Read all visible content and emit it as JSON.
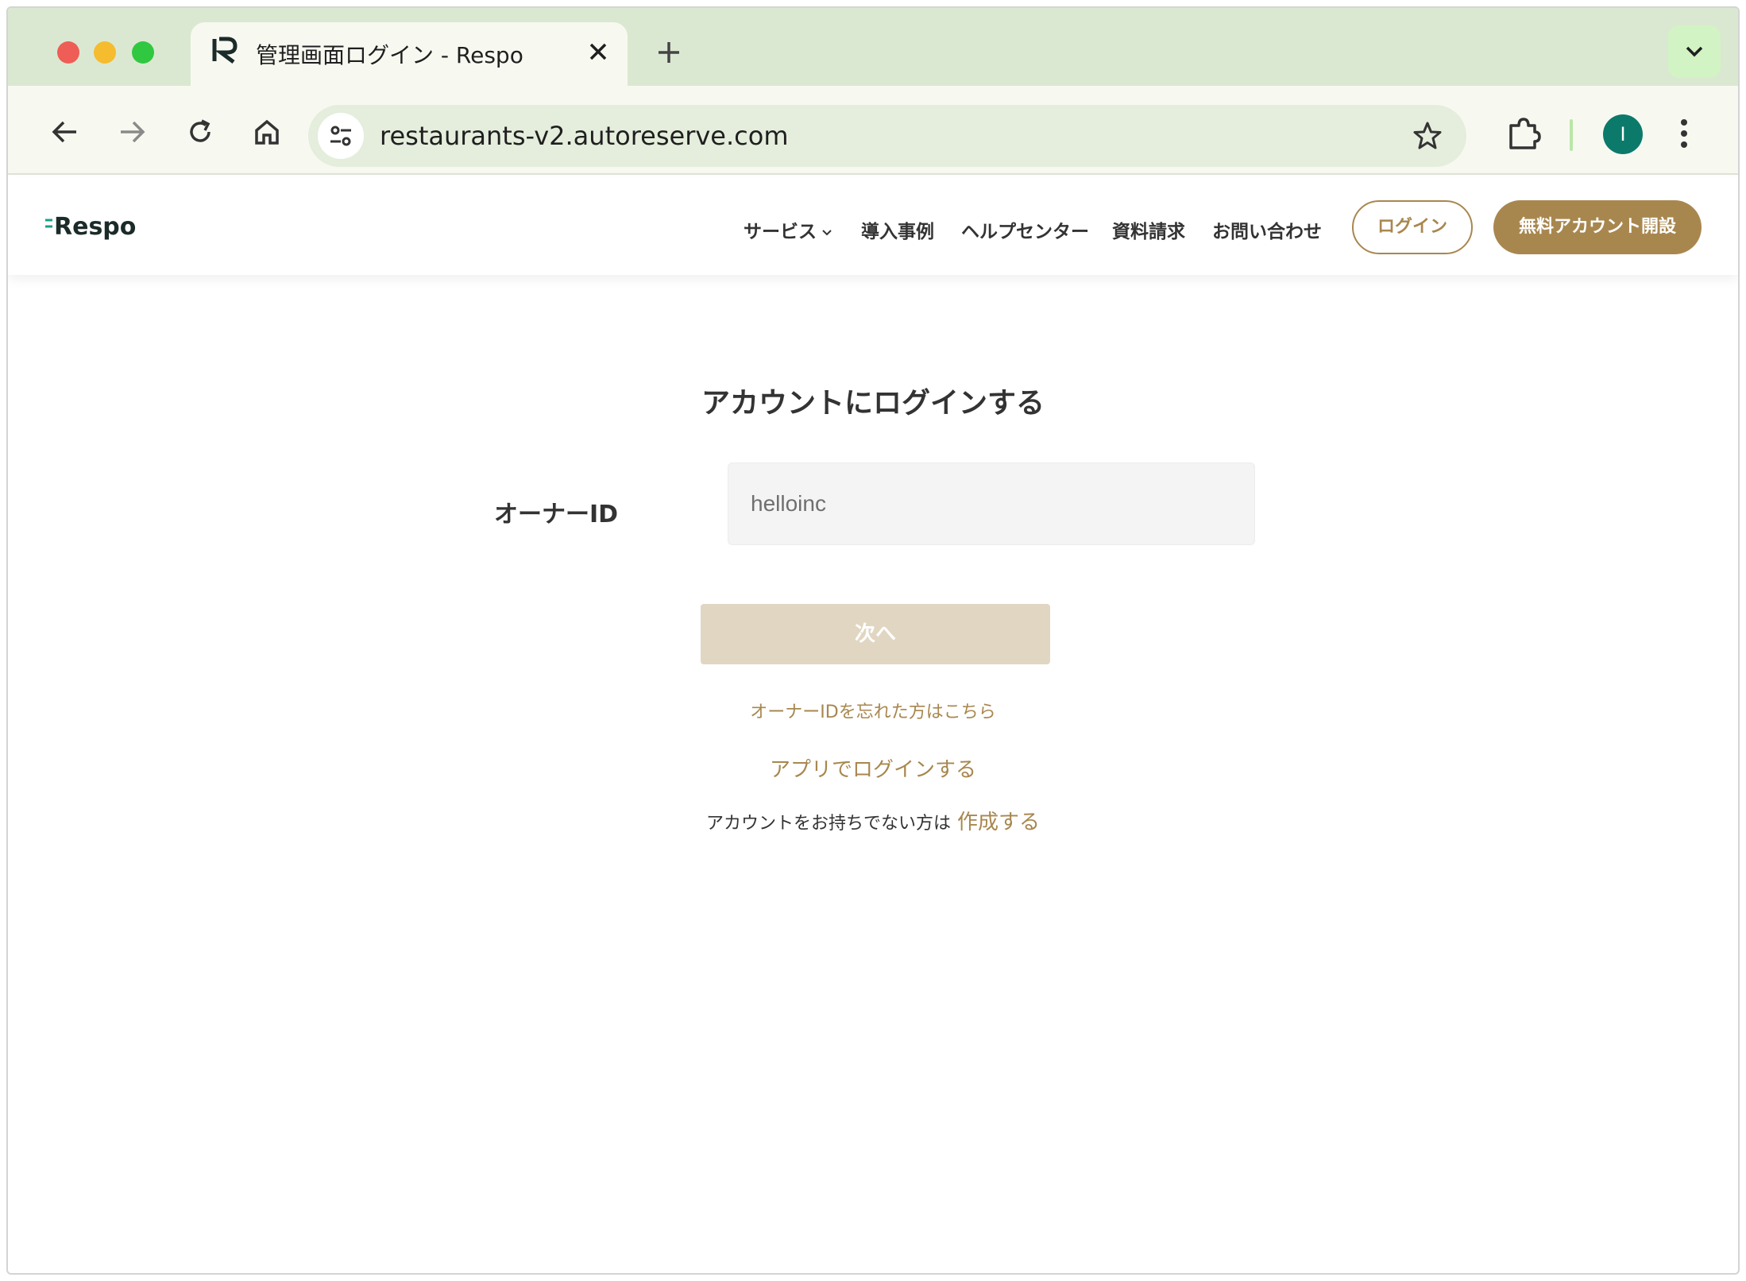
{
  "browser": {
    "tab_title": "管理画面ログイン - Respo",
    "url": "restaurants-v2.autoreserve.com",
    "avatar_letter": "I",
    "icons": [
      "back-icon",
      "forward-icon",
      "reload-icon",
      "home-icon",
      "tune-icon",
      "star-icon",
      "extensions-icon",
      "kebab-menu-icon",
      "new-tab-icon",
      "close-icon",
      "chevron-down-icon"
    ]
  },
  "site": {
    "logo": "Respo",
    "nav": [
      "サービス",
      "導入事例",
      "ヘルプセンター",
      "資料請求",
      "お問い合わせ"
    ],
    "login_button": "ログイン",
    "signup_button": "無料アカウント開設"
  },
  "login": {
    "title": "アカウントにログインする",
    "field_label": "オーナーID",
    "field_value": "helloinc",
    "next_button": "次へ",
    "forgot_link": "オーナーIDを忘れた方はこちら",
    "app_login_link": "アプリでログインする",
    "no_account_text": "アカウントをお持ちでない方は",
    "create_link": "作成する"
  },
  "colors": {
    "accent": "#a8874f",
    "chrome": "#dbe8d1",
    "button_disabled": "#e1d6c1"
  }
}
